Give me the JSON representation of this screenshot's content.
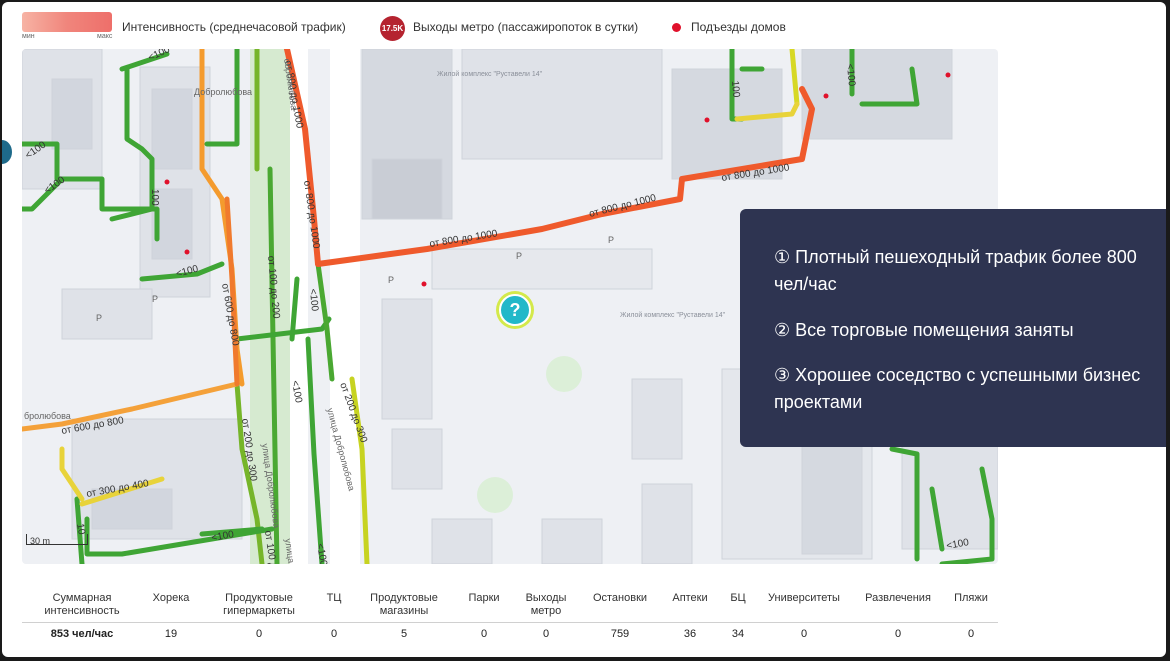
{
  "legend": {
    "gradient_min": "мин",
    "gradient_max": "макс",
    "intensity_label": "Интенсивность (среднечасовой трафик)",
    "metro_badge": "17.5K",
    "metro_label": "Выходы метро (пассажиропоток в сутки)",
    "entrances_label": "Подъезды домов",
    "colors": {
      "high": "#ee6f6a",
      "metro": "#b5232f",
      "entrance": "#e0112b"
    }
  },
  "map": {
    "segments": {
      "s1": "<100",
      "s2": "<100",
      "s3": "100",
      "s4": "<100",
      "s5": "от 600 до 800",
      "s6": "от 100 до 200",
      "s7": "от 800 до 1000",
      "s8": "от 800 до 1000",
      "s9": "от 800 до 1000",
      "s10": "от 800 до 1000",
      "s11": "от 800 до 1000",
      "s12": "<100",
      "s13": "100",
      "s14": "от 200 до 300",
      "s15": "от 600 до 800",
      "s16": "от 200 до 300",
      "s17": "<100",
      "s18": "от 300 до 400",
      "s19": "<100",
      "s20": "от 100 до 200",
      "s21": "<100",
      "s22": "<100",
      "s23": "<100",
      "s24": "<100",
      "s25": "10"
    },
    "streets": {
      "dobrolyubova_1": "Добролюбова",
      "dobrolyubova_2": "улица Добролюбова",
      "dobrolyubova_3": "улица Добролюбова",
      "dobrolyubova_4": "обролюбова",
      "dobrolyubova_5": "бролюбова",
      "dobrolyubova_6": "улица"
    },
    "complex_1": "Жилой комплекс \"Руставели 14\"",
    "complex_2": "Жилой комплекс \"Руставели 14\"",
    "parking": "P",
    "scale": "30 m",
    "question_mark": "?"
  },
  "panel": {
    "items": [
      "① Плотный пешеходный трафик более 800 чел/час",
      "② Все торговые помещения заняты",
      "③ Хорошее соседство с успешными бизнес проектами"
    ]
  },
  "stats": {
    "headers": [
      "Суммарная интенсивность",
      "Хорека",
      "Продуктовые гипермаркеты",
      "ТЦ",
      "Продуктовые магазины",
      "Парки",
      "Выходы метро",
      "Остановки",
      "Аптеки",
      "БЦ",
      "Университеты",
      "Развлечения",
      "Пляжи"
    ],
    "values": [
      "853 чел/час",
      "19",
      "0",
      "0",
      "5",
      "0",
      "0",
      "759",
      "36",
      "34",
      "0",
      "0",
      "0"
    ]
  }
}
